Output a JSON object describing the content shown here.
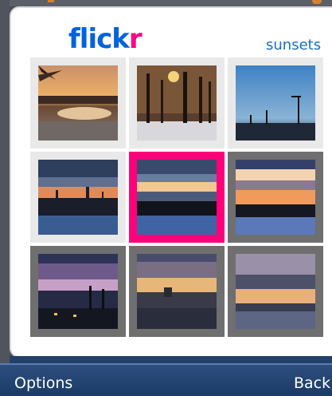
{
  "header": {
    "logo_part1": "flick",
    "logo_part2": "r",
    "tag": "sunsets"
  },
  "softkeys": {
    "left": "Options",
    "right": "Back"
  },
  "grid": {
    "columns": 3,
    "rows": 3,
    "selected_index": 4,
    "photos": [
      {
        "name": "thumb-1",
        "scene": "sunset over frozen pond with trees"
      },
      {
        "name": "thumb-2",
        "scene": "sun through bare trees in snow"
      },
      {
        "name": "thumb-3",
        "scene": "dusk blue sky with street lamps"
      },
      {
        "name": "thumb-4",
        "scene": "city skyline at sunset over water"
      },
      {
        "name": "thumb-5",
        "scene": "sunset band over shoreline"
      },
      {
        "name": "thumb-6",
        "scene": "orange horizon over water"
      },
      {
        "name": "thumb-7",
        "scene": "purple clouds over harbor"
      },
      {
        "name": "thumb-8",
        "scene": "golden clouds over town"
      },
      {
        "name": "thumb-9",
        "scene": "orange clouds at dusk"
      }
    ]
  },
  "colors": {
    "flickr_blue": "#0063dc",
    "flickr_pink": "#ff0084",
    "selection": "#ff007a",
    "softbar": "#1b3a66"
  }
}
